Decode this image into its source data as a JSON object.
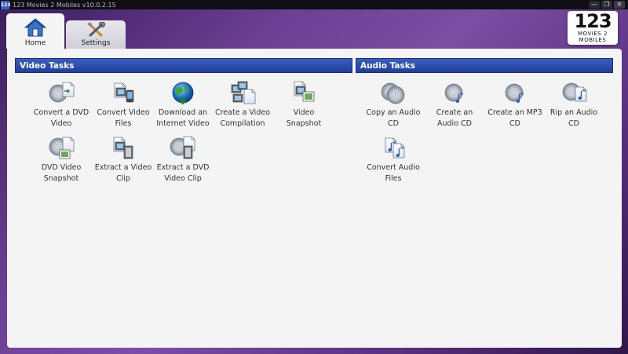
{
  "window": {
    "badge": "123",
    "title": "123 Movies 2 Mobiles v10.0.2.15",
    "controls": {
      "minimize": "—",
      "restore": "❐",
      "close": "✕"
    }
  },
  "logo": {
    "number": "123",
    "line1": "MOVIES 2",
    "line2": "MOBILES"
  },
  "tabs": [
    {
      "label": "Home",
      "icon": "home-icon",
      "active": true
    },
    {
      "label": "Settings",
      "icon": "tools-icon",
      "active": false
    }
  ],
  "video_tasks": {
    "header": "Video Tasks",
    "items": [
      {
        "line1": "Convert a DVD",
        "line2": "Video",
        "icon": "dvd-convert-icon"
      },
      {
        "line1": "Convert Video",
        "line2": "Files",
        "icon": "video-files-icon"
      },
      {
        "line1": "Download an",
        "line2": "Internet Video",
        "icon": "globe-download-icon"
      },
      {
        "line1": "Create a Video",
        "line2": "Compilation",
        "icon": "video-compilation-icon"
      },
      {
        "line1": "Video",
        "line2": "Snapshot",
        "icon": "video-snapshot-icon"
      },
      {
        "line1": "DVD Video",
        "line2": "Snapshot",
        "icon": "dvd-snapshot-icon"
      },
      {
        "line1": "Extract a Video",
        "line2": "Clip",
        "icon": "video-clip-icon"
      },
      {
        "line1": "Extract a DVD",
        "line2": "Video Clip",
        "icon": "dvd-clip-icon"
      }
    ]
  },
  "audio_tasks": {
    "header": "Audio Tasks",
    "items": [
      {
        "line1": "Copy an Audio",
        "line2": "CD",
        "icon": "copy-cd-icon"
      },
      {
        "line1": "Create an",
        "line2": "Audio CD",
        "icon": "create-audio-cd-icon"
      },
      {
        "line1": "Create an MP3",
        "line2": "CD",
        "icon": "create-mp3-cd-icon"
      },
      {
        "line1": "Rip an Audio",
        "line2": "CD",
        "icon": "rip-cd-icon"
      },
      {
        "line1": "Convert Audio",
        "line2": "Files",
        "icon": "audio-files-icon"
      }
    ]
  }
}
